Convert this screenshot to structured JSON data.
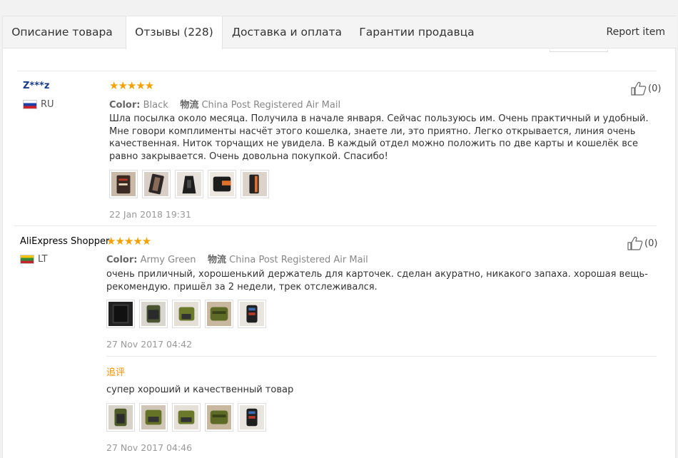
{
  "tabs": [
    {
      "label": "Описание товара"
    },
    {
      "label": "Отзывы (228)"
    },
    {
      "label": "Доставка и оплата"
    },
    {
      "label": "Гарантии продавца"
    }
  ],
  "report_label": "Report item",
  "reviews": [
    {
      "user": "Z***z",
      "country": "RU",
      "color_label": "Color:",
      "color_value": "Black",
      "shipping_label": "物流",
      "shipping_value": "China Post Registered Air Mail",
      "text": "Шла посылка около месяца. Получила в начале января. Сейчас пользуюсь им. Очень практичный и удобный. Мне говори комплименты насчёт этого кошелка, знаете ли, это приятно. Легко открывается, линия очень качественная. Ниток торчащих не увидела. В каждый отдел можно положить по две карты и кошелёк все равно закрывается. Очень довольна покупкой. Спасибо!",
      "date": "22 Jan 2018 19:31",
      "likes": "(0)",
      "stars": "★★★★★",
      "rating": 5
    },
    {
      "user": "AliExpress Shopper",
      "country": "LT",
      "color_label": "Color:",
      "color_value": "Army Green",
      "shipping_label": "物流",
      "shipping_value": "China Post Registered Air Mail",
      "text": "очень приличный, хорошенький держатель для карточек. сделан акуратно, никакого запаха. хорошая вещь- рекомендую. пришёл за 2 недели, трек отслеживался.",
      "date": "27 Nov 2017 04:42",
      "likes": "(0)",
      "stars": "★★★★★",
      "rating": 5,
      "additional": {
        "label": "追评",
        "text": "супер хороший и качественный товар",
        "date": "27 Nov 2017 04:46"
      }
    }
  ],
  "colors": {
    "star": "#f2a100",
    "user_link": "#1a3c8c",
    "additional_label": "#f29100"
  }
}
